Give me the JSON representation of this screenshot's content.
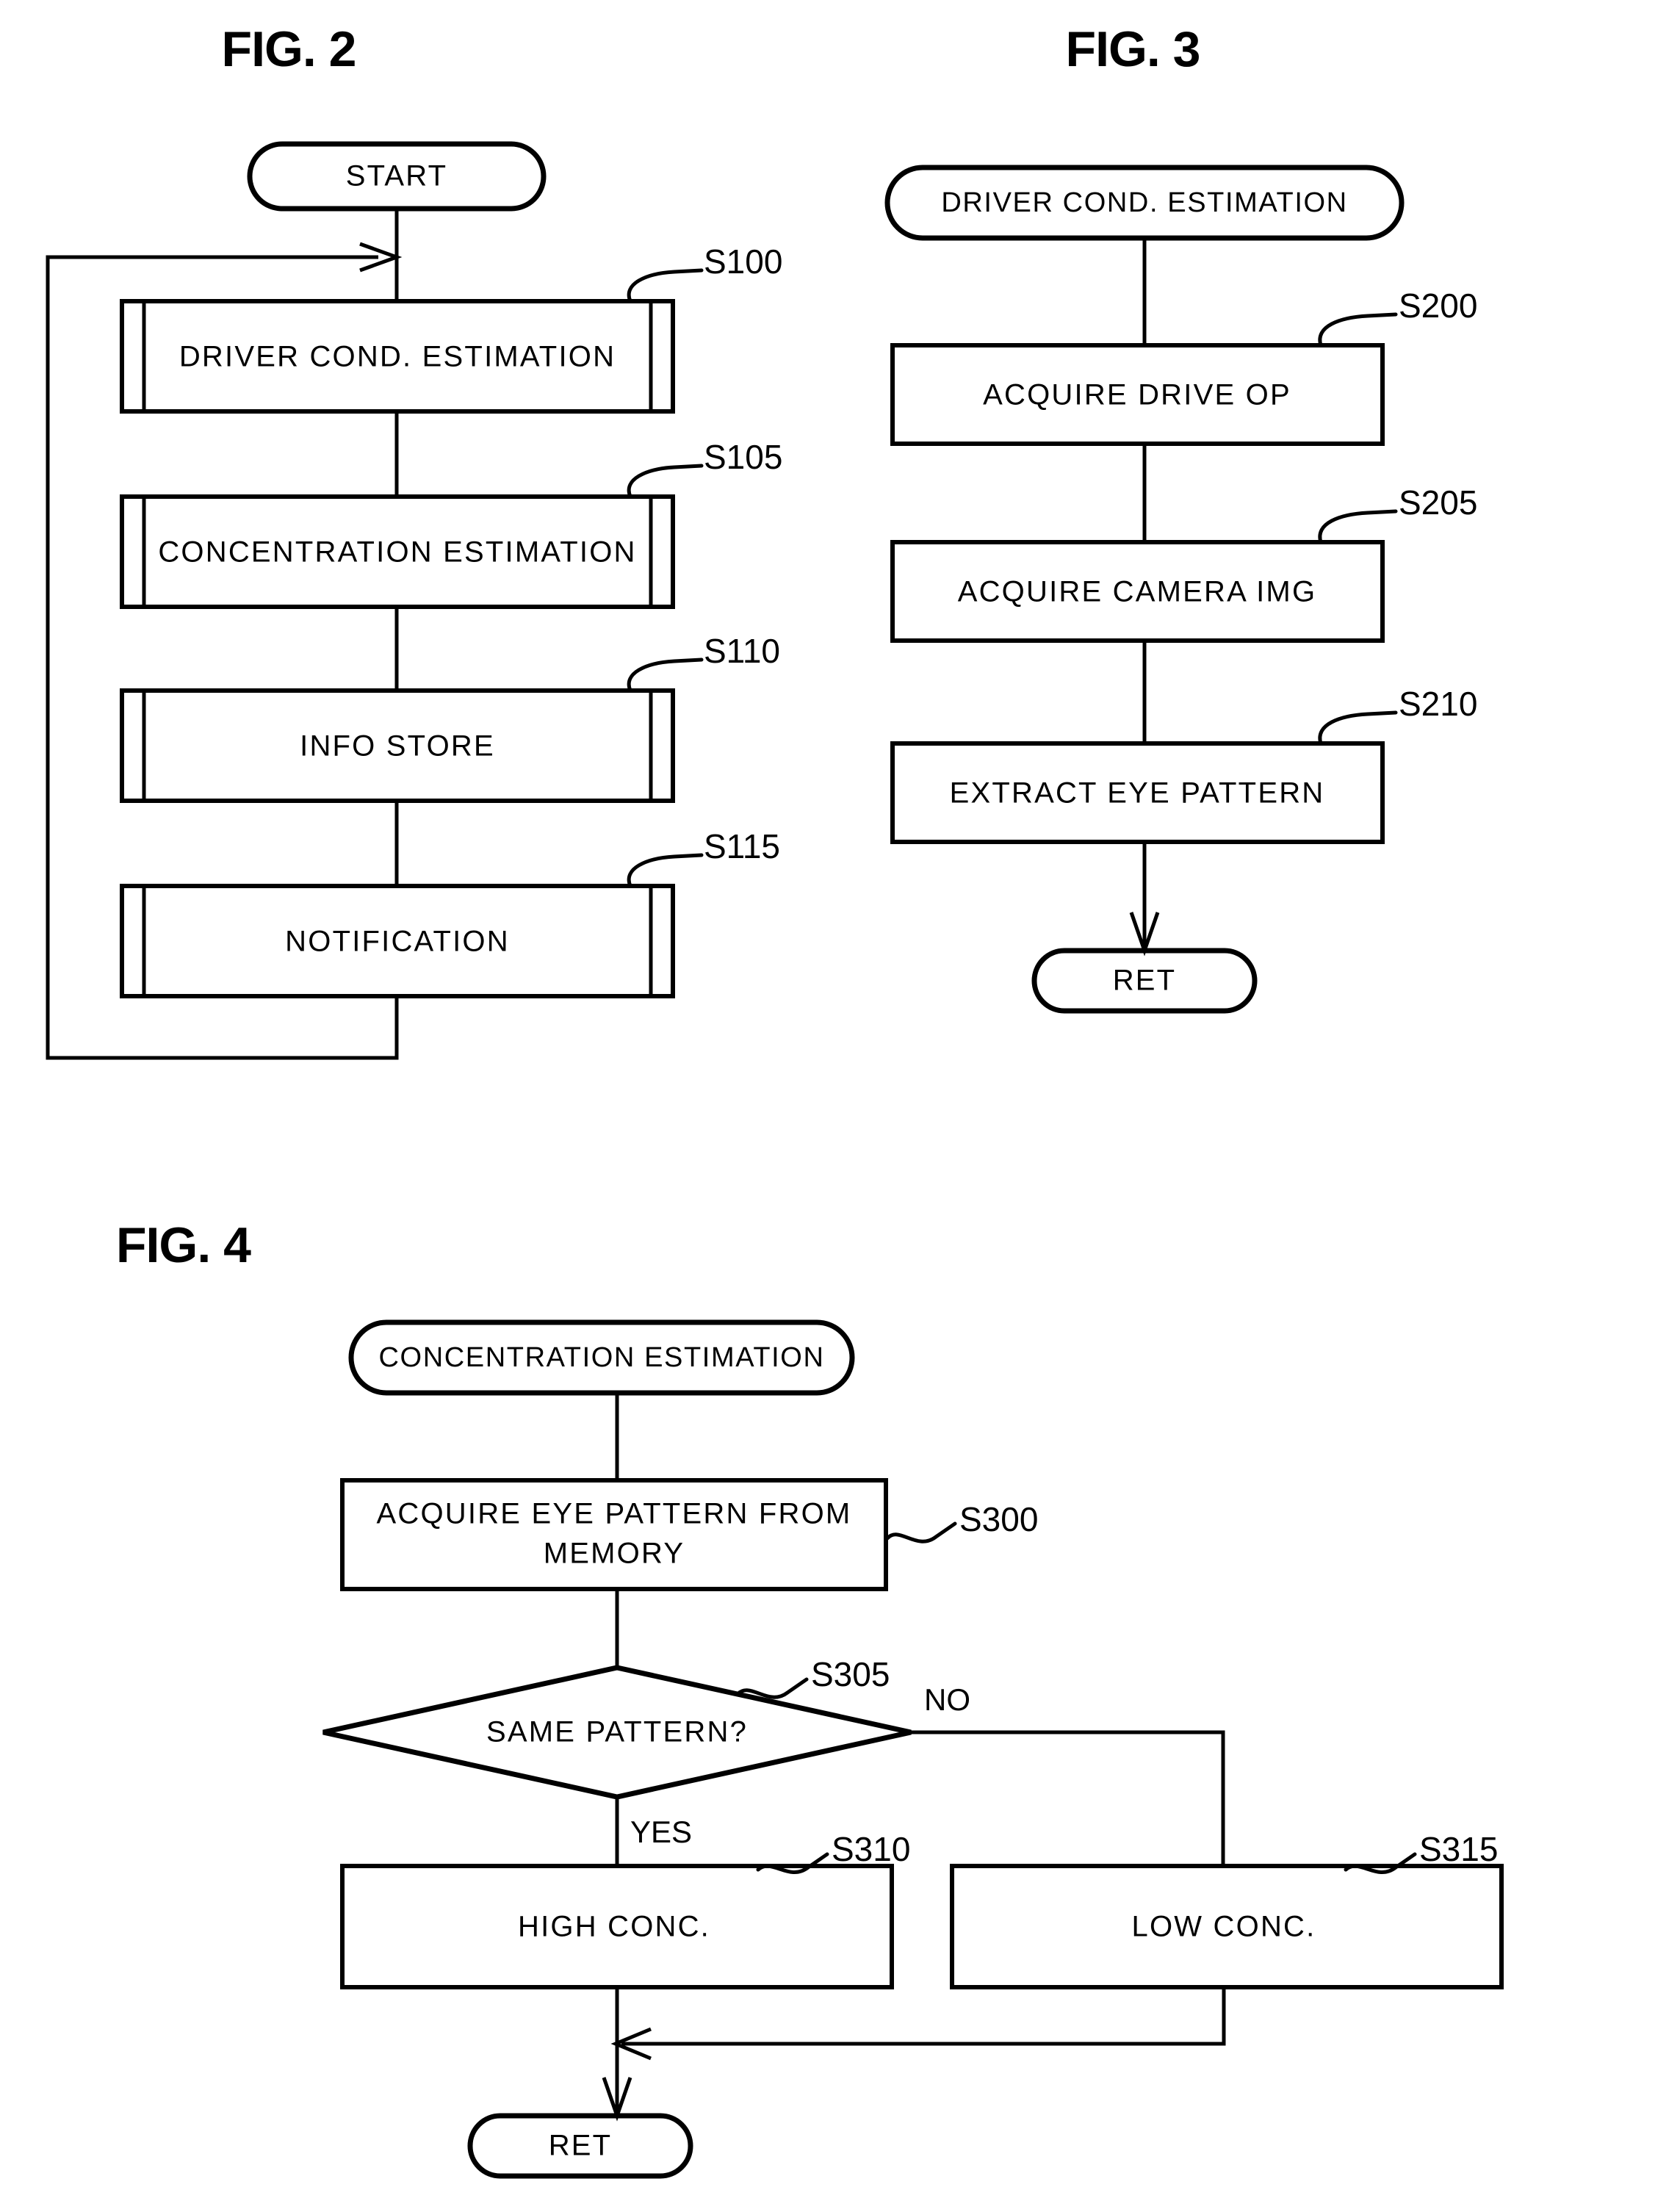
{
  "figures": [
    {
      "id": "fig2",
      "title": "FIG. 2",
      "nodes": {
        "start": "START",
        "s100": "DRIVER COND.  ESTIMATION",
        "s105": "CONCENTRATION ESTIMATION",
        "s110": "INFO STORE",
        "s115": "NOTIFICATION"
      },
      "step_labels": {
        "s100": "S100",
        "s105": "S105",
        "s110": "S110",
        "s115": "S115"
      }
    },
    {
      "id": "fig3",
      "title": "FIG. 3",
      "nodes": {
        "entry": "DRIVER COND.  ESTIMATION",
        "s200": "ACQUIRE DRIVE OP",
        "s205": "ACQUIRE CAMERA IMG",
        "s210": "EXTRACT EYE PATTERN",
        "ret": "RET"
      },
      "step_labels": {
        "s200": "S200",
        "s205": "S205",
        "s210": "S210"
      }
    },
    {
      "id": "fig4",
      "title": "FIG. 4",
      "nodes": {
        "entry": "CONCENTRATION ESTIMATION",
        "s300_line1": "ACQUIRE EYE PATTERN FROM",
        "s300_line2": "MEMORY",
        "s305": "SAME PATTERN?",
        "s310": "HIGH CONC.",
        "s315": "LOW CONC.",
        "ret": "RET"
      },
      "step_labels": {
        "s300": "S300",
        "s305": "S305",
        "s310": "S310",
        "s315": "S315"
      },
      "branch_labels": {
        "no": "NO",
        "yes": "YES"
      }
    }
  ],
  "colors": {
    "ink": "#000000",
    "paper": "#ffffff"
  }
}
